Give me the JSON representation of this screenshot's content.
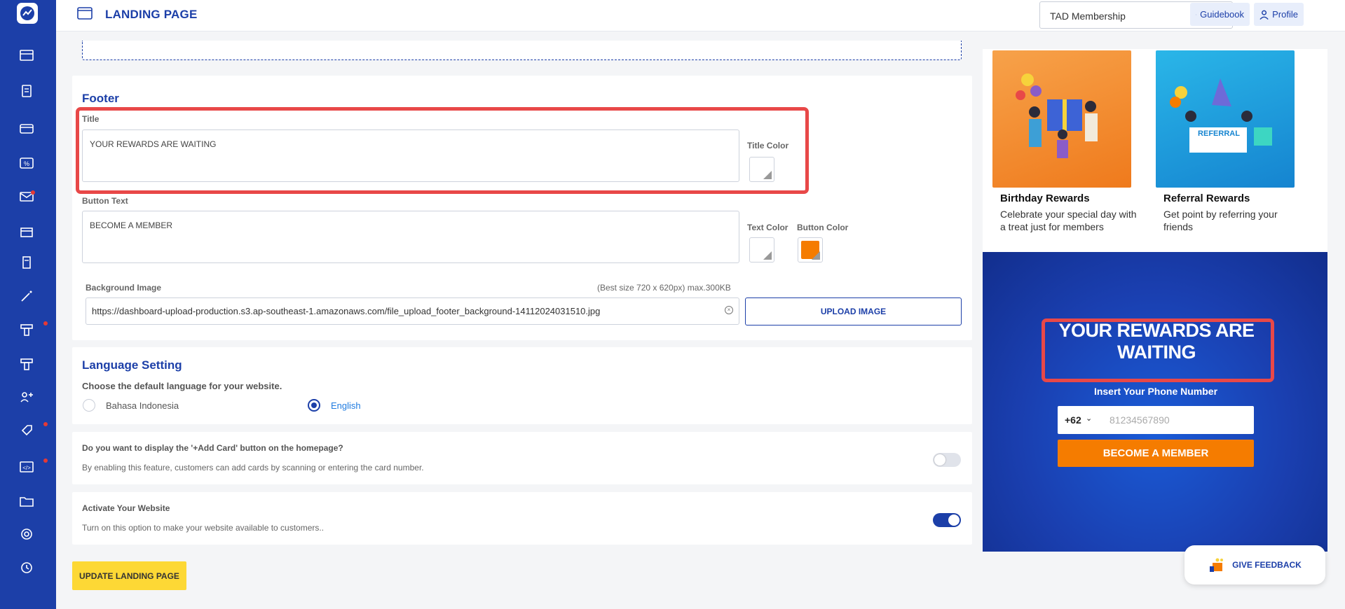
{
  "topbar": {
    "title": "LANDING PAGE",
    "membership_select": "TAD Membership",
    "guidebook_label": "Guidebook",
    "profile_label": "Profile"
  },
  "footer_section": {
    "heading": "Footer",
    "title_label": "Title",
    "title_value": "YOUR REWARDS ARE WAITING",
    "title_color_label": "Title Color",
    "button_text_label": "Button Text",
    "button_text_value": "BECOME A MEMBER",
    "text_color_label": "Text Color",
    "button_color_label": "Button Color",
    "button_color": "#f57c00",
    "background_image_label": "Background Image",
    "background_hint": "(Best size 720 x 620px) max.300KB",
    "background_url": "https://dashboard-upload-production.s3.ap-southeast-1.amazonaws.com/file_upload_footer_background-14112024031510.jpg",
    "upload_label": "UPLOAD IMAGE"
  },
  "language_section": {
    "heading": "Language Setting",
    "description": "Choose the default language for your website.",
    "options": [
      "Bahasa Indonesia",
      "English"
    ],
    "selected": "English"
  },
  "add_card_section": {
    "question": "Do you want to display the '+Add Card' button on the homepage?",
    "description": "By enabling this feature, customers can add cards by scanning or entering the card number.",
    "enabled": false
  },
  "activate_section": {
    "title": "Activate Your Website",
    "description": "Turn on this option to make your website available to customers..",
    "enabled": true
  },
  "update_button": "UPDATE LANDING PAGE",
  "preview": {
    "promos": [
      {
        "title": "Birthday Rewards",
        "description": "Celebrate your special day with a treat just for members"
      },
      {
        "title": "Referral Rewards",
        "description": "Get point by referring your friends"
      }
    ],
    "referral_banner": "REFERRAL",
    "footer_title": "YOUR REWARDS ARE WAITING",
    "phone_label": "Insert Your Phone Number",
    "phone_code": "+62",
    "phone_placeholder": "81234567890",
    "cta": "BECOME A MEMBER"
  },
  "feedback_label": "GIVE FEEDBACK",
  "colors": {
    "primary": "#1c3fa8",
    "accent_orange": "#f57c00",
    "highlight_red": "#e84848",
    "update_yellow": "#fdd835"
  }
}
